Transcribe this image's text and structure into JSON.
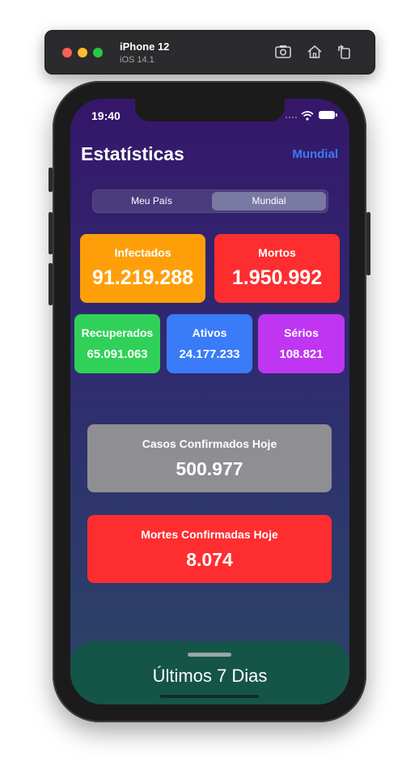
{
  "simulator": {
    "device_name": "iPhone 12",
    "os_version": "iOS 14.1",
    "icons": [
      "screenshot-icon",
      "home-icon",
      "rotate-icon"
    ]
  },
  "status_bar": {
    "time": "19:40"
  },
  "header": {
    "title": "Estatísticas",
    "region_link": "Mundial"
  },
  "segmented_control": {
    "options": [
      "Meu País",
      "Mundial"
    ],
    "selected": "Mundial"
  },
  "stats": {
    "infected": {
      "label": "Infectados",
      "value": "91.219.288",
      "color": "#fe9f0a"
    },
    "deaths": {
      "label": "Mortos",
      "value": "1.950.992",
      "color": "#fe2d30"
    },
    "recovered": {
      "label": "Recuperados",
      "value": "65.091.063",
      "color": "#30d158"
    },
    "active": {
      "label": "Ativos",
      "value": "24.177.233",
      "color": "#3a7bf7"
    },
    "serious": {
      "label": "Sérios",
      "value": "108.821",
      "color": "#bf35f2"
    }
  },
  "today": {
    "confirmed_cases": {
      "label": "Casos Confirmados Hoje",
      "value": "500.977",
      "color": "#8e8e93"
    },
    "confirmed_deaths": {
      "label": "Mortes Confirmadas Hoje",
      "value": "8.074",
      "color": "#fe2d30"
    }
  },
  "bottom_sheet": {
    "title": "Últimos 7 Dias",
    "color": "#155548"
  }
}
